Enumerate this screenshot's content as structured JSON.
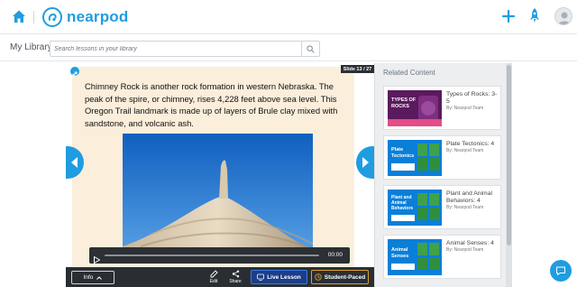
{
  "app": {
    "logo_text": "nearpod",
    "brand_color": "#1f9de0"
  },
  "header": {
    "home_icon": "home-icon",
    "add_icon": "plus-icon",
    "launch_icon": "rocket-icon",
    "profile_icon": "avatar"
  },
  "subbar": {
    "library_label": "My Library",
    "search_placeholder": "Search lessons in your library",
    "search_icon": "search-icon"
  },
  "slide": {
    "counter": "Slide 13 / 27",
    "text": "Chimney Rock is another rock formation in western Nebraska. The peak of the spire, or chimney, rises 4,228 feet above sea level. This Oregon Trail landmark is made up of layers of Brule clay mixed with sandstone, and volcanic ash.",
    "video_time": "00:00",
    "video_progress": 0
  },
  "toolbar": {
    "info_label": "Info",
    "edit_label": "Edit",
    "share_label": "Share",
    "live_label": "Live Lesson",
    "student_label": "Student-Paced"
  },
  "related": {
    "title": "Related Content",
    "items": [
      {
        "title": "Types of Rocks: 3-5",
        "by": "By: Nearpod Team",
        "thumb_text": "TYPES OF ROCKS",
        "thumb_color": "#5b1a5e"
      },
      {
        "title": "Plate Tectonics: 4",
        "by": "By: Nearpod Team",
        "thumb_text": "Plate Tectonics",
        "thumb_color": "#0a7fd8"
      },
      {
        "title": "Plant and Animal Behaviors: 4",
        "by": "By: Nearpod Team",
        "thumb_text": "Plant and Animal Behaviors",
        "thumb_color": "#0a7fd8"
      },
      {
        "title": "Animal Senses: 4",
        "by": "By: Nearpod Team",
        "thumb_text": "Animal Senses",
        "thumb_color": "#0a7fd8"
      }
    ]
  }
}
